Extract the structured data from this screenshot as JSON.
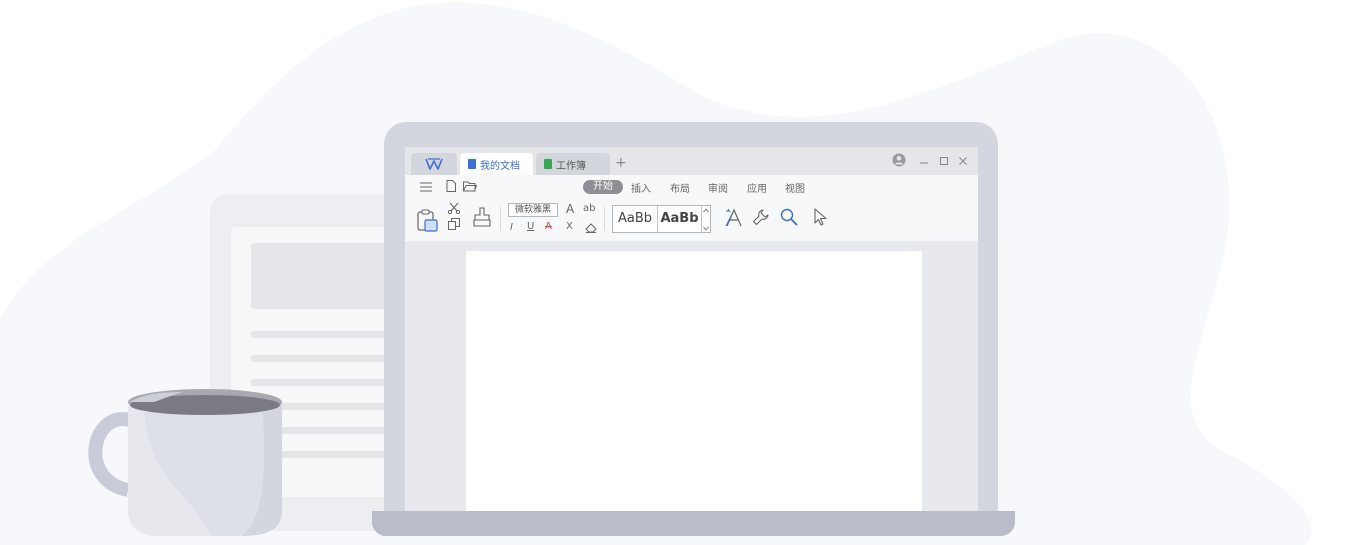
{
  "colors": {
    "blob": "#f6f8fc",
    "laptop_frame": "#d3d6df",
    "laptop_base": "#b9bcc9",
    "accent_blue": "#3a6fd8",
    "doc_green": "#36a852",
    "menu_active_bg": "#8e8f94"
  },
  "titlebar": {
    "home_icon": "wps-logo-icon",
    "tabs": [
      {
        "label": "我的文档",
        "icon": "document-icon",
        "active": true
      },
      {
        "label": "工作簿",
        "icon": "spreadsheet-icon",
        "active": false
      }
    ],
    "new_tab": "+",
    "controls": [
      "user-icon",
      "minimize-icon",
      "maximize-icon",
      "close-icon"
    ]
  },
  "menu": {
    "items": [
      {
        "label": "开始",
        "active": true
      },
      {
        "label": "插入",
        "active": false
      },
      {
        "label": "布局",
        "active": false
      },
      {
        "label": "审阅",
        "active": false
      },
      {
        "label": "应用",
        "active": false
      },
      {
        "label": "视图",
        "active": false
      }
    ]
  },
  "toolbar": {
    "font_name": "微软雅黑",
    "font_size_glyph": "A",
    "spacing_glyph": "ab",
    "italic": "I",
    "underline": "U",
    "strike": "A",
    "subscript": "X",
    "style_normal": "AaBb",
    "style_heading": "AaBb"
  }
}
